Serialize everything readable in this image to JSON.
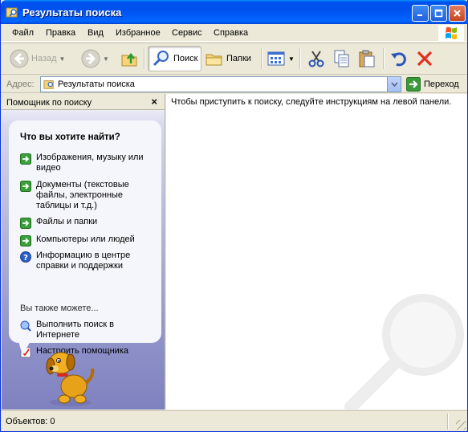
{
  "window": {
    "title": "Результаты поиска",
    "title_icon": "search-results-folder-icon",
    "accent_color": "#0053ee"
  },
  "menu": {
    "items": [
      "Файл",
      "Правка",
      "Вид",
      "Избранное",
      "Сервис",
      "Справка"
    ]
  },
  "toolbar": {
    "back_label": "Назад",
    "search_label": "Поиск",
    "folders_label": "Папки"
  },
  "address": {
    "label": "Адрес:",
    "value": "Результаты поиска",
    "go_label": "Переход"
  },
  "assistant": {
    "pane_title": "Помощник по поиску",
    "question": "Что вы хотите найти?",
    "options": [
      {
        "label": "Изображения, музыку или видео",
        "icon": "green-arrow-icon"
      },
      {
        "label": "Документы (текстовые файлы, электронные таблицы и т.д.)",
        "icon": "green-arrow-icon"
      },
      {
        "label": "Файлы и папки",
        "icon": "green-arrow-icon"
      },
      {
        "label": "Компьютеры или людей",
        "icon": "green-arrow-icon"
      },
      {
        "label": "Информацию в центре справки и поддержки",
        "icon": "help-icon"
      }
    ],
    "also_label": "Вы также можете...",
    "also_options": [
      {
        "label": "Выполнить поиск в Интернете",
        "icon": "internet-search-icon"
      },
      {
        "label": "Настроить помощника",
        "icon": "settings-checklist-icon"
      }
    ]
  },
  "content": {
    "instruction": "Чтобы приступить к поиску, следуйте инструкциям на левой панели."
  },
  "status": {
    "text": "Объектов: 0"
  }
}
